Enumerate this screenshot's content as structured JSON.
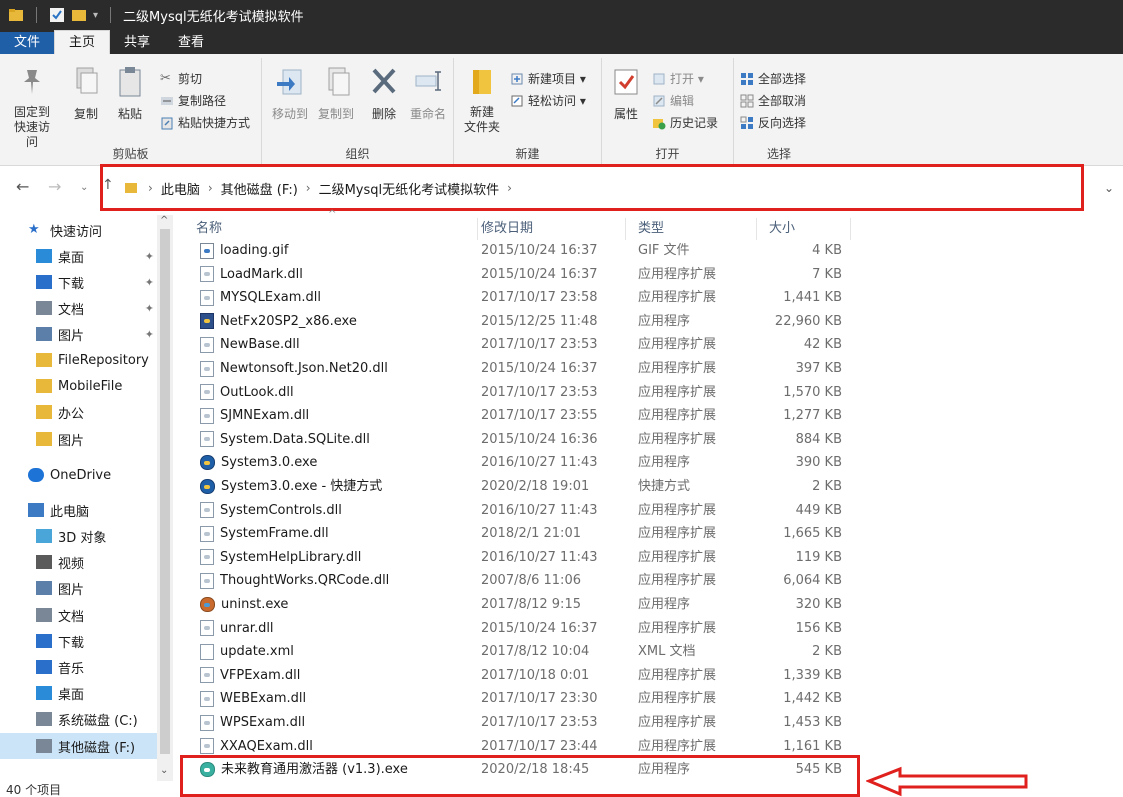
{
  "window": {
    "title": "二级Mysql无纸化考试模拟软件"
  },
  "ribbon_tabs": [
    "文件",
    "主页",
    "共享",
    "查看"
  ],
  "ribbon": {
    "clipboard": {
      "pin_label": "固定到\n快速访问",
      "copy_label": "复制",
      "paste_label": "粘贴",
      "cut_label": "剪切",
      "copy_path_label": "复制路径",
      "paste_shortcut_label": "粘贴快捷方式",
      "group_label": "剪贴板"
    },
    "organize": {
      "move_to_label": "移动到",
      "copy_to_label": "复制到",
      "delete_label": "删除",
      "rename_label": "重命名",
      "group_label": "组织"
    },
    "new": {
      "new_folder_label": "新建\n文件夹",
      "new_item_label": "新建项目 ▾",
      "easy_access_label": "轻松访问 ▾",
      "group_label": "新建"
    },
    "open": {
      "properties_label": "属性",
      "open_label": "打开 ▾",
      "edit_label": "编辑",
      "history_label": "历史记录",
      "group_label": "打开"
    },
    "select": {
      "select_all_label": "全部选择",
      "select_none_label": "全部取消",
      "invert_label": "反向选择",
      "group_label": "选择"
    }
  },
  "address": {
    "crumbs": [
      "此电脑",
      "其他磁盘 (F:)",
      "二级Mysql无纸化考试模拟软件"
    ]
  },
  "sidebar": {
    "items": [
      {
        "label": "快速访问",
        "icon": "star-icon",
        "pinned": false
      },
      {
        "label": "桌面",
        "icon": "desktop-icon",
        "pinned": true
      },
      {
        "label": "下载",
        "icon": "download-icon",
        "pinned": true
      },
      {
        "label": "文档",
        "icon": "document-icon",
        "pinned": true
      },
      {
        "label": "图片",
        "icon": "picture-icon",
        "pinned": true
      },
      {
        "label": "FileRepository",
        "icon": "folder-icon",
        "pinned": false
      },
      {
        "label": "MobileFile",
        "icon": "folder-icon",
        "pinned": false
      },
      {
        "label": "办公",
        "icon": "folder-icon",
        "pinned": false
      },
      {
        "label": "图片",
        "icon": "folder-icon",
        "pinned": false
      },
      {
        "label": "OneDrive",
        "icon": "cloud-icon",
        "pinned": false
      },
      {
        "label": "此电脑",
        "icon": "computer-icon",
        "pinned": false
      },
      {
        "label": "3D 对象",
        "icon": "cube-icon",
        "pinned": false
      },
      {
        "label": "视频",
        "icon": "video-icon",
        "pinned": false
      },
      {
        "label": "图片",
        "icon": "picture-icon",
        "pinned": false
      },
      {
        "label": "文档",
        "icon": "document-icon",
        "pinned": false
      },
      {
        "label": "下载",
        "icon": "download-icon",
        "pinned": false
      },
      {
        "label": "音乐",
        "icon": "music-icon",
        "pinned": false
      },
      {
        "label": "桌面",
        "icon": "desktop-icon",
        "pinned": false
      },
      {
        "label": "系统磁盘 (C:)",
        "icon": "drive-icon",
        "pinned": false
      },
      {
        "label": "其他磁盘 (F:)",
        "icon": "drive-icon",
        "pinned": false
      }
    ]
  },
  "columns": {
    "name": "名称",
    "date": "修改日期",
    "type": "类型",
    "size": "大小"
  },
  "files": [
    {
      "name": "loading.gif",
      "date": "2015/10/24 16:37",
      "type": "GIF 文件",
      "size": "4 KB",
      "icon": "gif-file-icon"
    },
    {
      "name": "LoadMark.dll",
      "date": "2015/10/24 16:37",
      "type": "应用程序扩展",
      "size": "7 KB",
      "icon": "dll-file-icon"
    },
    {
      "name": "MYSQLExam.dll",
      "date": "2017/10/17 23:58",
      "type": "应用程序扩展",
      "size": "1,441 KB",
      "icon": "dll-file-icon"
    },
    {
      "name": "NetFx20SP2_x86.exe",
      "date": "2015/12/25 11:48",
      "type": "应用程序",
      "size": "22,960 KB",
      "icon": "installer-exe-icon"
    },
    {
      "name": "NewBase.dll",
      "date": "2017/10/17 23:53",
      "type": "应用程序扩展",
      "size": "42 KB",
      "icon": "dll-file-icon"
    },
    {
      "name": "Newtonsoft.Json.Net20.dll",
      "date": "2015/10/24 16:37",
      "type": "应用程序扩展",
      "size": "397 KB",
      "icon": "dll-file-icon"
    },
    {
      "name": "OutLook.dll",
      "date": "2017/10/17 23:53",
      "type": "应用程序扩展",
      "size": "1,570 KB",
      "icon": "dll-file-icon"
    },
    {
      "name": "SJMNExam.dll",
      "date": "2017/10/17 23:55",
      "type": "应用程序扩展",
      "size": "1,277 KB",
      "icon": "dll-file-icon"
    },
    {
      "name": "System.Data.SQLite.dll",
      "date": "2015/10/24 16:36",
      "type": "应用程序扩展",
      "size": "884 KB",
      "icon": "dll-file-icon"
    },
    {
      "name": "System3.0.exe",
      "date": "2016/10/27 11:43",
      "type": "应用程序",
      "size": "390 KB",
      "icon": "app-exe-icon"
    },
    {
      "name": "System3.0.exe - 快捷方式",
      "date": "2020/2/18 19:01",
      "type": "快捷方式",
      "size": "2 KB",
      "icon": "shortcut-icon"
    },
    {
      "name": "SystemControls.dll",
      "date": "2016/10/27 11:43",
      "type": "应用程序扩展",
      "size": "449 KB",
      "icon": "dll-file-icon"
    },
    {
      "name": "SystemFrame.dll",
      "date": "2018/2/1 21:01",
      "type": "应用程序扩展",
      "size": "1,665 KB",
      "icon": "dll-file-icon"
    },
    {
      "name": "SystemHelpLibrary.dll",
      "date": "2016/10/27 11:43",
      "type": "应用程序扩展",
      "size": "119 KB",
      "icon": "dll-file-icon"
    },
    {
      "name": "ThoughtWorks.QRCode.dll",
      "date": "2007/8/6 11:06",
      "type": "应用程序扩展",
      "size": "6,064 KB",
      "icon": "dll-file-icon"
    },
    {
      "name": "uninst.exe",
      "date": "2017/8/12 9:15",
      "type": "应用程序",
      "size": "320 KB",
      "icon": "uninstaller-icon"
    },
    {
      "name": "unrar.dll",
      "date": "2015/10/24 16:37",
      "type": "应用程序扩展",
      "size": "156 KB",
      "icon": "dll-file-icon"
    },
    {
      "name": "update.xml",
      "date": "2017/8/12 10:04",
      "type": "XML 文档",
      "size": "2 KB",
      "icon": "xml-file-icon"
    },
    {
      "name": "VFPExam.dll",
      "date": "2017/10/18 0:01",
      "type": "应用程序扩展",
      "size": "1,339 KB",
      "icon": "dll-file-icon"
    },
    {
      "name": "WEBExam.dll",
      "date": "2017/10/17 23:30",
      "type": "应用程序扩展",
      "size": "1,442 KB",
      "icon": "dll-file-icon"
    },
    {
      "name": "WPSExam.dll",
      "date": "2017/10/17 23:53",
      "type": "应用程序扩展",
      "size": "1,453 KB",
      "icon": "dll-file-icon"
    },
    {
      "name": "XXAQExam.dll",
      "date": "2017/10/17 23:44",
      "type": "应用程序扩展",
      "size": "1,161 KB",
      "icon": "dll-file-icon"
    },
    {
      "name": "未来教育通用激活器 (v1.3).exe",
      "date": "2020/2/18 18:45",
      "type": "应用程序",
      "size": "545 KB",
      "icon": "activator-exe-icon"
    }
  ],
  "status": {
    "item_count": "40 个项目"
  },
  "colors": {
    "annotation_red": "#e0201d",
    "title_bar": "#2b2b2b",
    "file_tab": "#1f5fa8",
    "selected_nav": "#cce4f7"
  }
}
